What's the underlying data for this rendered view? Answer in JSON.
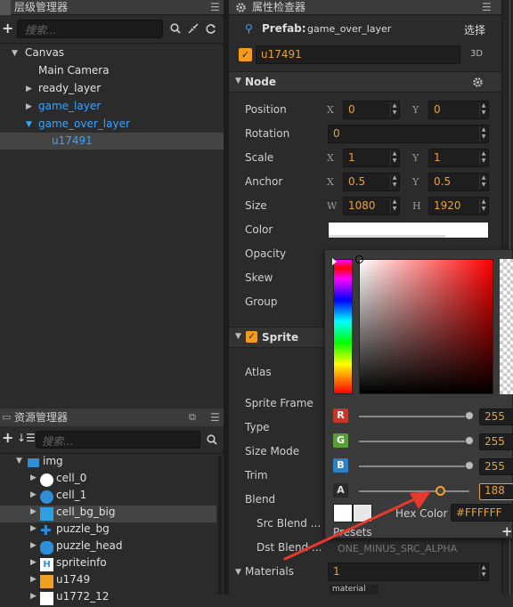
{
  "hierarchy": {
    "title": "层级管理器",
    "search_placeholder": "搜索...",
    "nodes": [
      {
        "label": "Canvas"
      },
      {
        "label": "Main Camera"
      },
      {
        "label": "ready_layer"
      },
      {
        "label": "game_layer"
      },
      {
        "label": "game_over_layer"
      },
      {
        "label": "u17491"
      }
    ]
  },
  "assets": {
    "title": "资源管理器",
    "search_placeholder": "搜索...",
    "items": [
      {
        "label": "img"
      },
      {
        "label": "cell_0"
      },
      {
        "label": "cell_1"
      },
      {
        "label": "cell_bg_big"
      },
      {
        "label": "puzzle_bg"
      },
      {
        "label": "puzzle_head"
      },
      {
        "label": "spriteinfo"
      },
      {
        "label": "u1749"
      },
      {
        "label": "u1772_12"
      }
    ]
  },
  "inspector": {
    "title": "属性检查器",
    "prefab_label": "Prefab:",
    "prefab_name": "game_over_layer",
    "select_label": "选择",
    "node_name": "u17491",
    "badge_3d": "3D",
    "node_section": "Node",
    "props": {
      "position": {
        "label": "Position",
        "x_axis": "X",
        "x": "0",
        "y_axis": "Y",
        "y": "0"
      },
      "rotation": {
        "label": "Rotation",
        "value": "0"
      },
      "scale": {
        "label": "Scale",
        "x_axis": "X",
        "x": "1",
        "y_axis": "Y",
        "y": "1"
      },
      "anchor": {
        "label": "Anchor",
        "x_axis": "X",
        "x": "0.5",
        "y_axis": "Y",
        "y": "0.5"
      },
      "size": {
        "label": "Size",
        "w_axis": "W",
        "w": "1080",
        "h_axis": "H",
        "h": "1920"
      },
      "color": {
        "label": "Color"
      },
      "opacity": {
        "label": "Opacity"
      },
      "skew": {
        "label": "Skew"
      },
      "group": {
        "label": "Group"
      }
    },
    "sprite_section": "Sprite",
    "sprite_props": {
      "atlas": "Atlas",
      "sprite_frame": "Sprite Frame",
      "type": "Type",
      "size_mode": "Size Mode",
      "trim": "Trim",
      "blend": "Blend",
      "src_blend": "Src Blend ...",
      "dst_blend": "Dst Blend ..."
    },
    "dst_blend_value": "ONE_MINUS_SRC_ALPHA",
    "materials_label": "Materials",
    "materials_count": "1",
    "material_tag": "material"
  },
  "color_picker": {
    "r_label": "R",
    "r_value": "255",
    "g_label": "G",
    "g_value": "255",
    "b_label": "B",
    "b_value": "255",
    "a_label": "A",
    "a_value": "188",
    "hex_label": "Hex Color",
    "hex_value": "#FFFFFF",
    "presets_label": "Presets",
    "presets_add": "+",
    "colors": {
      "r": "#c0392b",
      "g": "#5a9e3a",
      "b": "#2f7fc1",
      "accent": "#f0a030",
      "annotation": "#e8392c"
    }
  }
}
